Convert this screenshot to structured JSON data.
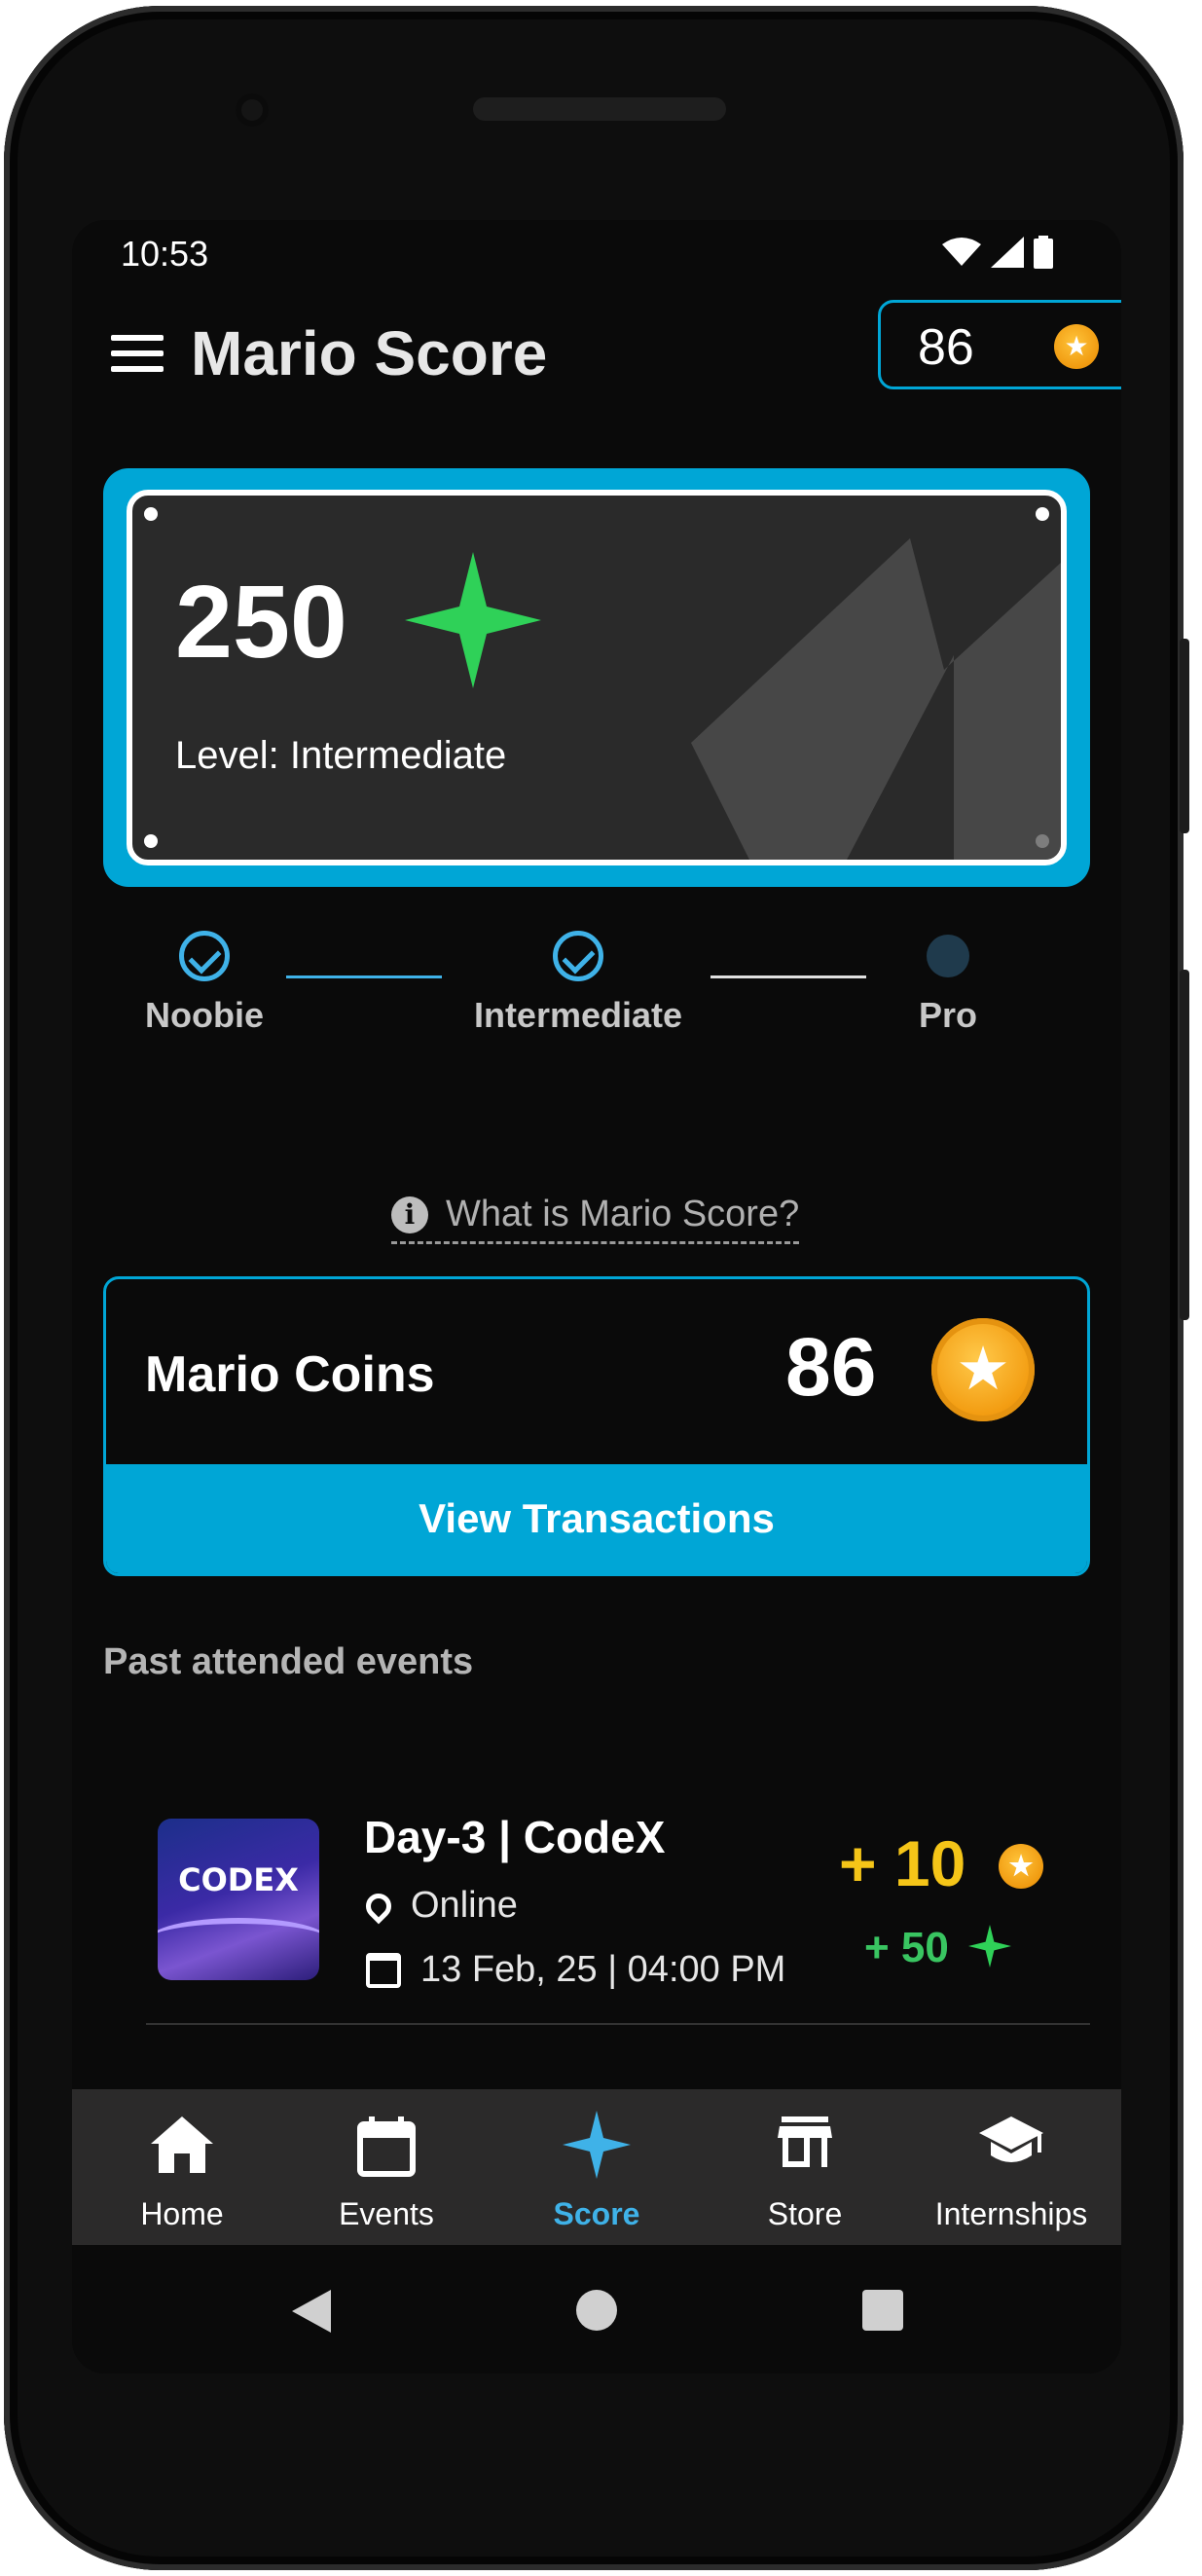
{
  "status_bar": {
    "time": "10:53"
  },
  "header": {
    "title": "Mario Score",
    "coin_balance": "86"
  },
  "score_card": {
    "score": "250",
    "level_text": "Level: Intermediate"
  },
  "levels": [
    {
      "label": "Noobie",
      "state": "done"
    },
    {
      "label": "Intermediate",
      "state": "done"
    },
    {
      "label": "Pro",
      "state": "pending"
    }
  ],
  "info_link": "What is Mario Score?",
  "coins_card": {
    "title": "Mario Coins",
    "value": "86",
    "button_label": "View Transactions"
  },
  "past_events": {
    "title": "Past attended events",
    "items": [
      {
        "thumbnail_text": "CODEX",
        "title": "Day-3 | CodeX",
        "location": "Online",
        "datetime": "13 Feb, 25 | 04:00 PM",
        "coins": "+ 10",
        "score": "+ 50"
      }
    ]
  },
  "bottom_nav": [
    {
      "label": "Home",
      "icon": "home-icon"
    },
    {
      "label": "Events",
      "icon": "calendar-icon"
    },
    {
      "label": "Score",
      "icon": "sparkle-icon",
      "active": true
    },
    {
      "label": "Store",
      "icon": "store-icon"
    },
    {
      "label": "Internships",
      "icon": "graduation-cap-icon"
    }
  ],
  "colors": {
    "accent": "#00a6d6",
    "green": "#2fd158",
    "gold": "#f5c518",
    "background": "#0a0a0a"
  }
}
